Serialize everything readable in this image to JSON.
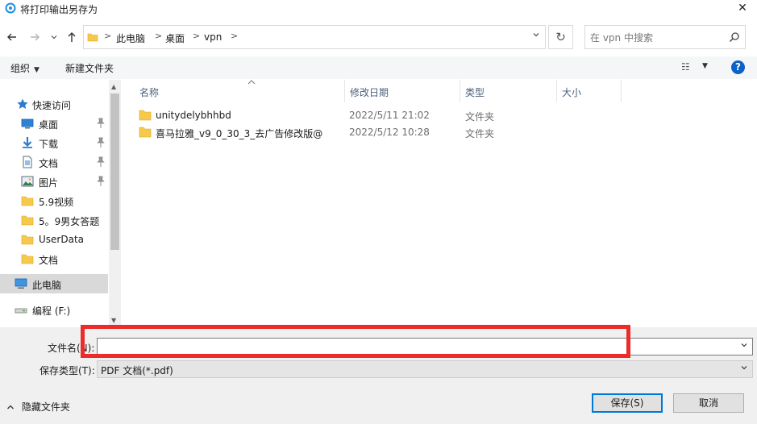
{
  "window": {
    "title": "将打印输出另存为",
    "close_glyph": "✕"
  },
  "addressbar": {
    "breadcrumbs": [
      "此电脑",
      "桌面",
      "vpn"
    ],
    "separator": ">",
    "dropdown_glyph": "⌄",
    "refresh_glyph": "↻"
  },
  "search": {
    "placeholder": "在 vpn 中搜索"
  },
  "toolbar": {
    "organize_label": "组织",
    "new_folder_label": "新建文件夹",
    "view_glyph": "☷",
    "help_label": "?"
  },
  "nav": {
    "items": [
      {
        "label": "快速访问",
        "icon": "star-icon",
        "pinned": false
      },
      {
        "label": "桌面",
        "icon": "desktop-icon",
        "pinned": true
      },
      {
        "label": "下载",
        "icon": "download-icon",
        "pinned": true
      },
      {
        "label": "文档",
        "icon": "document-icon",
        "pinned": true
      },
      {
        "label": "图片",
        "icon": "picture-icon",
        "pinned": true
      },
      {
        "label": "5.9视频",
        "icon": "folder-icon",
        "pinned": false
      },
      {
        "label": "5。9男女答题",
        "icon": "folder-icon",
        "pinned": false
      },
      {
        "label": "UserData",
        "icon": "folder-icon",
        "pinned": false
      },
      {
        "label": "文档",
        "icon": "folder-icon",
        "pinned": false
      },
      {
        "label": "此电脑",
        "icon": "computer-icon",
        "pinned": false,
        "selected": true
      },
      {
        "label": "编程 (F:)",
        "icon": "drive-icon",
        "pinned": false
      }
    ]
  },
  "columns": [
    "名称",
    "修改日期",
    "类型",
    "大小"
  ],
  "files": [
    {
      "name": "unitydelybhhbd",
      "date": "2022/5/11 21:02",
      "type": "文件夹",
      "size": ""
    },
    {
      "name": "喜马拉雅_v9_0_30_3_去广告修改版@",
      "date": "2022/5/12 10:28",
      "type": "文件夹",
      "size": ""
    }
  ],
  "form": {
    "filename_label": "文件名(N):",
    "filename_value": "",
    "filetype_label": "保存类型(T):",
    "filetype_value": "PDF 文档(*.pdf)"
  },
  "footer": {
    "hide_folders_label": "隐藏文件夹",
    "save_label": "保存(S)",
    "cancel_label": "取消"
  },
  "colors": {
    "accent": "#0078d7",
    "highlight_box": "#ec2b2b",
    "folder": "#f7c94b"
  }
}
